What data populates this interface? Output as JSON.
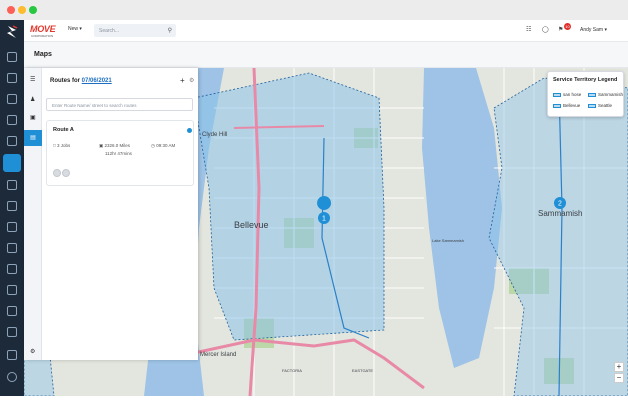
{
  "app": {
    "brand": "MOVE",
    "brand_sub": "CORPORATION",
    "new_label": "New",
    "search_placeholder": "Search...",
    "notification_count": "10",
    "user_name": "Andy Sam"
  },
  "page": {
    "title": "Maps"
  },
  "routes_panel": {
    "heading": "Routes for",
    "date": "07/06/2021",
    "search_placeholder": "Enter Route Name/ street to search routes",
    "route": {
      "name": "Route A",
      "jobs": "3 Jobs",
      "distance": "2326.0 Miles",
      "duration": "112hr 47mins",
      "time": "09:30 AM"
    }
  },
  "legend": {
    "title": "Service Territory Legend",
    "items": [
      "san hose",
      "Sammamish",
      "Bellevue",
      "Seattle"
    ]
  },
  "map": {
    "labels": {
      "bellevue": "Bellevue",
      "sammamish": "Sammamish",
      "clyde_hill": "Clyde Hill",
      "lake_sammamish": "Lake Sammamish",
      "factoria": "FACTORIA",
      "eastgate": "EASTGATE",
      "mercer_island": "Mercer Island",
      "marker_1": "1",
      "marker_2": "2"
    },
    "zoom_in": "+",
    "zoom_out": "−"
  },
  "icons": {
    "color_accent": "#1f8fd6",
    "color_territory": "#8cc3ea",
    "color_highway": "#e88aa7"
  }
}
